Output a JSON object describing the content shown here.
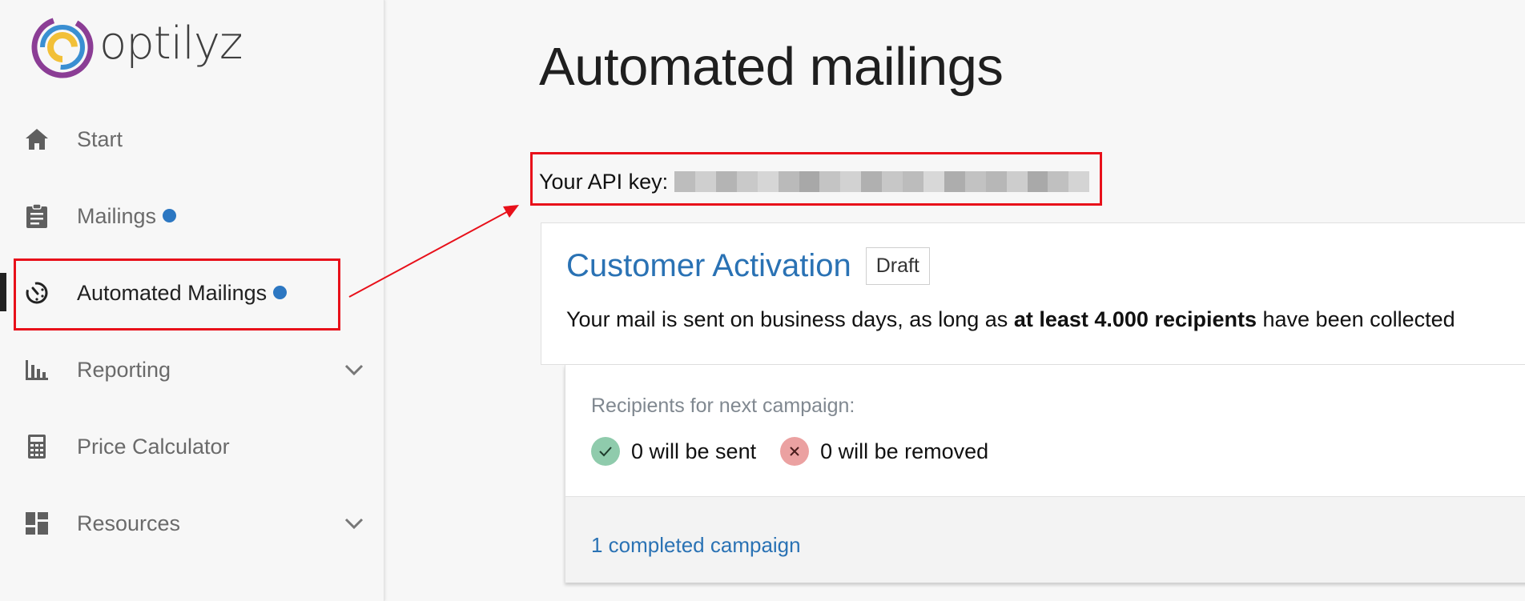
{
  "brand": {
    "name": "optilyz"
  },
  "sidebar": {
    "items": [
      {
        "label": "Start",
        "icon": "home-icon"
      },
      {
        "label": "Mailings",
        "icon": "clipboard-icon",
        "dot": true
      },
      {
        "label": "Automated Mailings",
        "icon": "automation-clock-icon",
        "dot": true,
        "active": true
      },
      {
        "label": "Reporting",
        "icon": "bar-chart-icon",
        "expandable": true
      },
      {
        "label": "Price Calculator",
        "icon": "calculator-icon"
      },
      {
        "label": "Resources",
        "icon": "dashboard-icon",
        "expandable": true
      }
    ]
  },
  "main": {
    "title": "Automated mailings",
    "api_key_label": "Your API key:",
    "campaign": {
      "title": "Customer Activation",
      "status_badge": "Draft",
      "description_prefix": "Your mail is sent on business days, as long as ",
      "description_bold": "at least 4.000 recipients",
      "description_suffix": " have been collected",
      "recipients_label": "Recipients for next campaign:",
      "will_be_sent": "0 will be sent",
      "will_be_removed": "0 will be removed",
      "completed_link": "1 completed campaign"
    }
  },
  "colors": {
    "accent_blue": "#2c77c2",
    "link_blue": "#2a72b4",
    "annotation_red": "#e8101a",
    "success_green": "#8fcbac",
    "danger_red": "#eba1a1"
  }
}
